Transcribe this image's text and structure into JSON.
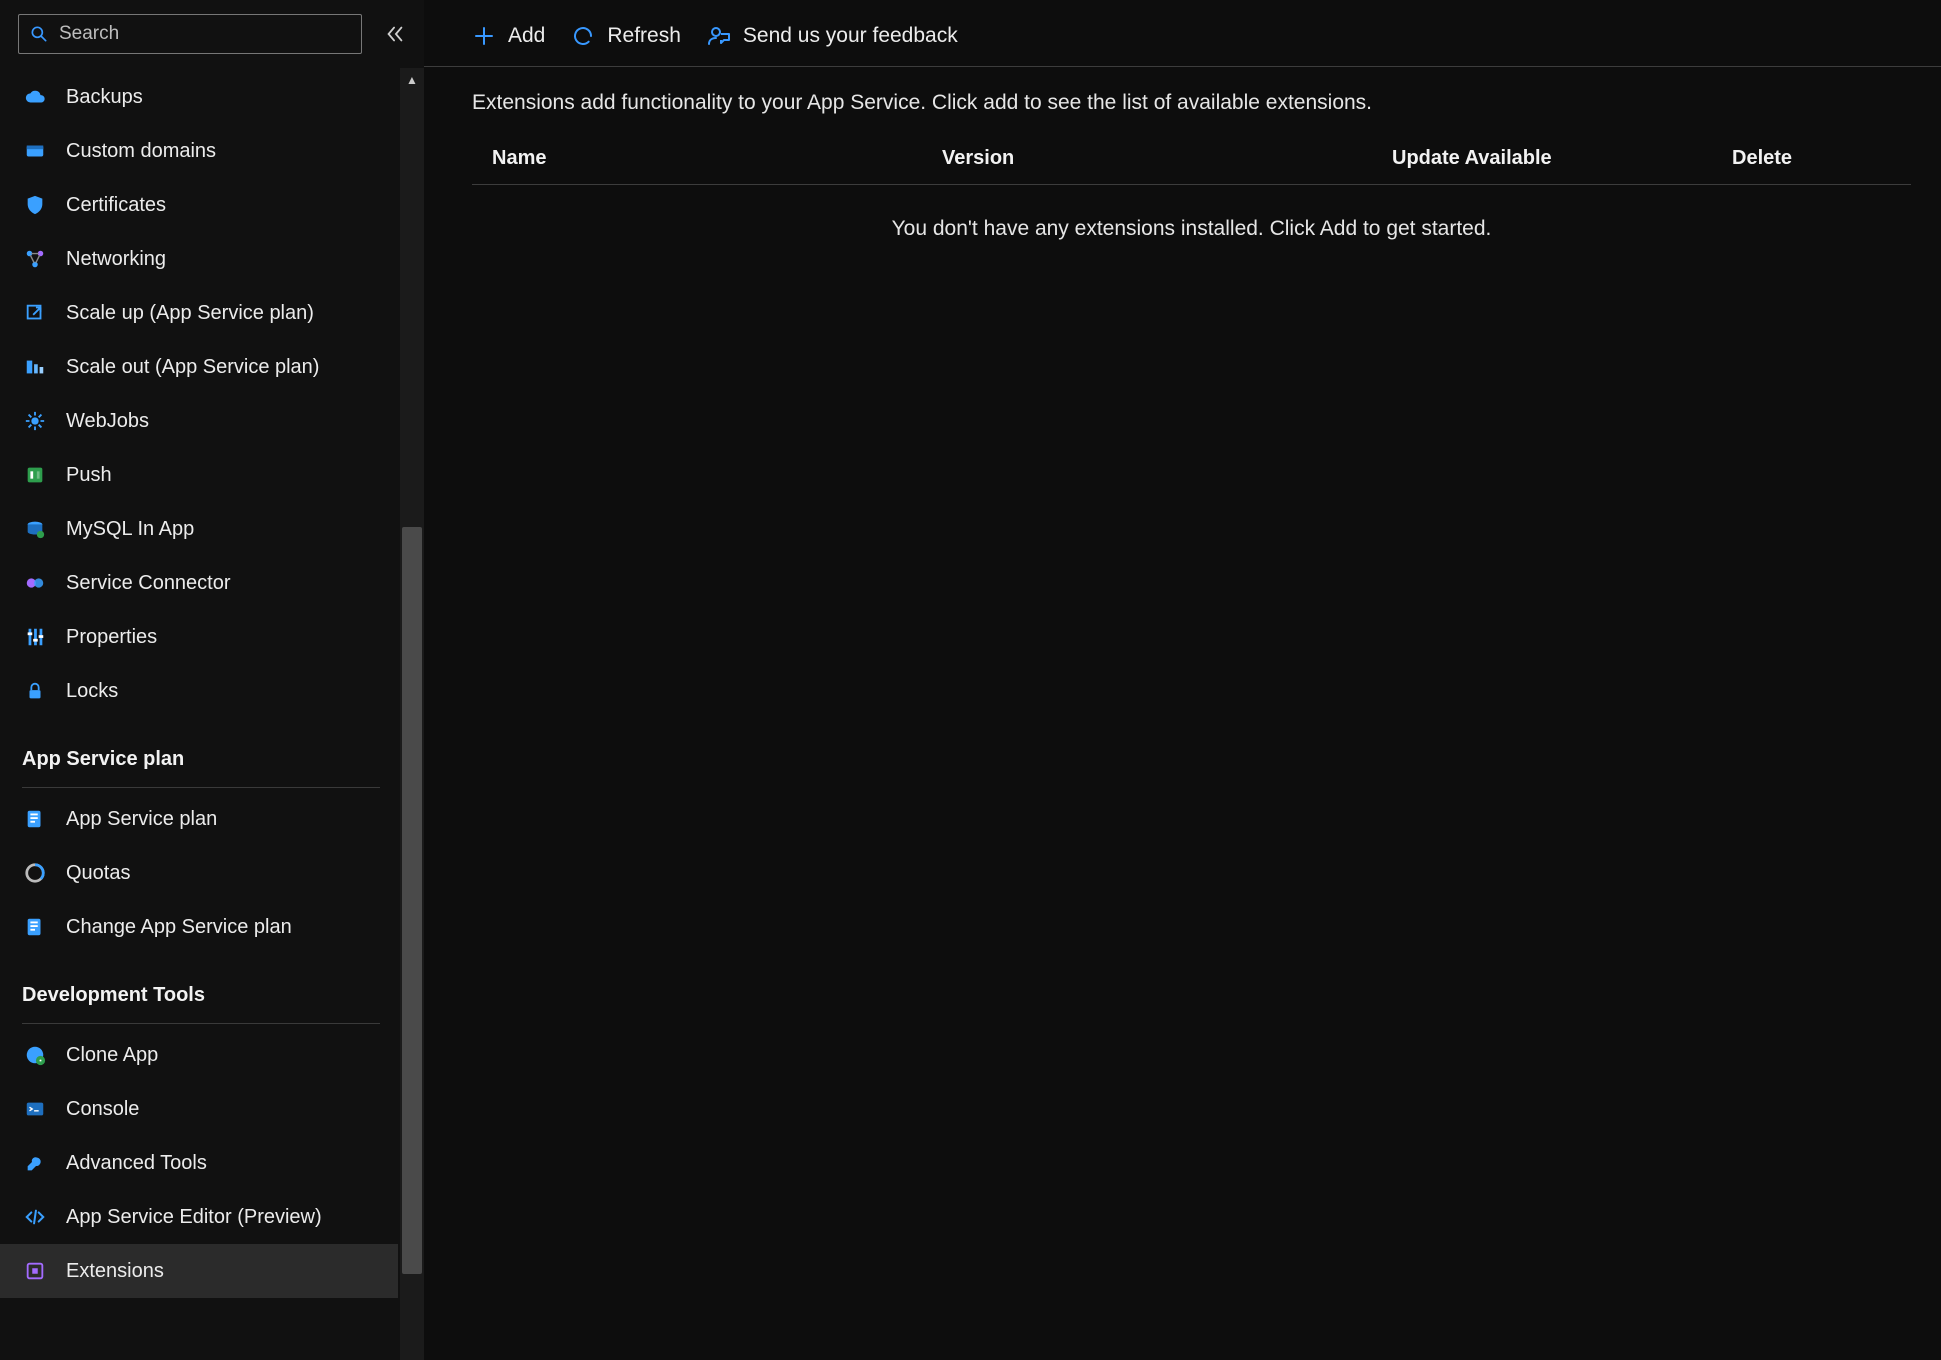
{
  "sidebar": {
    "search_placeholder": "Search",
    "groups": [
      {
        "header": null,
        "items": [
          {
            "id": "backups",
            "label": "Backups",
            "icon": "cloud",
            "active": false
          },
          {
            "id": "custom-domains",
            "label": "Custom domains",
            "icon": "domain",
            "active": false
          },
          {
            "id": "certificates",
            "label": "Certificates",
            "icon": "shield",
            "active": false
          },
          {
            "id": "networking",
            "label": "Networking",
            "icon": "network",
            "active": false
          },
          {
            "id": "scale-up",
            "label": "Scale up (App Service plan)",
            "icon": "scaleup",
            "active": false
          },
          {
            "id": "scale-out",
            "label": "Scale out (App Service plan)",
            "icon": "scaleout",
            "active": false
          },
          {
            "id": "webjobs",
            "label": "WebJobs",
            "icon": "gear",
            "active": false
          },
          {
            "id": "push",
            "label": "Push",
            "icon": "push",
            "active": false
          },
          {
            "id": "mysql-in-app",
            "label": "MySQL In App",
            "icon": "mysql",
            "active": false
          },
          {
            "id": "service-connector",
            "label": "Service Connector",
            "icon": "connector",
            "active": false
          },
          {
            "id": "properties",
            "label": "Properties",
            "icon": "properties",
            "active": false
          },
          {
            "id": "locks",
            "label": "Locks",
            "icon": "lock",
            "active": false
          }
        ]
      },
      {
        "header": "App Service plan",
        "items": [
          {
            "id": "app-service-plan",
            "label": "App Service plan",
            "icon": "plan",
            "active": false
          },
          {
            "id": "quotas",
            "label": "Quotas",
            "icon": "quota",
            "active": false
          },
          {
            "id": "change-app-service-plan",
            "label": "Change App Service plan",
            "icon": "plan",
            "active": false
          }
        ]
      },
      {
        "header": "Development Tools",
        "items": [
          {
            "id": "clone-app",
            "label": "Clone App",
            "icon": "clone",
            "active": false
          },
          {
            "id": "console",
            "label": "Console",
            "icon": "console",
            "active": false
          },
          {
            "id": "advanced-tools",
            "label": "Advanced Tools",
            "icon": "wrench",
            "active": false
          },
          {
            "id": "app-service-editor",
            "label": "App Service Editor (Preview)",
            "icon": "code",
            "active": false
          },
          {
            "id": "extensions",
            "label": "Extensions",
            "icon": "extension",
            "active": true
          }
        ]
      }
    ]
  },
  "toolbar": {
    "add": "Add",
    "refresh": "Refresh",
    "feedback": "Send us your feedback"
  },
  "content": {
    "intro": "Extensions add functionality to your App Service. Click add to see the list of available extensions.",
    "columns": {
      "name": "Name",
      "version": "Version",
      "update": "Update Available",
      "delete": "Delete"
    },
    "empty": "You don't have any extensions installed. Click Add to get started."
  },
  "scrollbar": {
    "thumb_top_pct": 35,
    "thumb_height_pct": 60
  }
}
